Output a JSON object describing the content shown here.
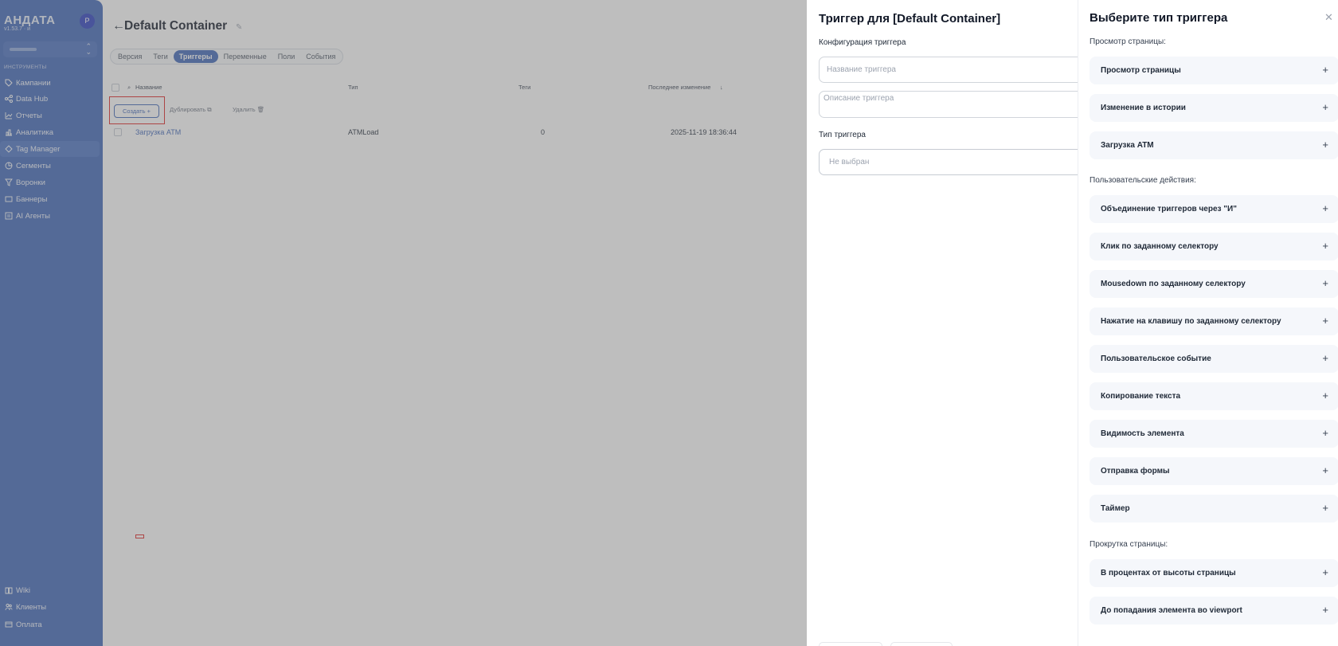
{
  "sidebar": {
    "logo": "АНДАТА",
    "version": "v1.53.7 · и",
    "avatar": "Р",
    "section": "ИНСТРУМЕНТЫ",
    "items": [
      {
        "label": "Кампании",
        "icon": "tag-icon"
      },
      {
        "label": "Data Hub",
        "icon": "share-icon"
      },
      {
        "label": "Отчеты",
        "icon": "chart-line-icon"
      },
      {
        "label": "Аналитика",
        "icon": "bar-chart-icon"
      },
      {
        "label": "Tag Manager",
        "icon": "diamond-icon"
      },
      {
        "label": "Сегменты",
        "icon": "pie-icon"
      },
      {
        "label": "Воронки",
        "icon": "funnel-icon"
      },
      {
        "label": "Баннеры",
        "icon": "banner-icon"
      },
      {
        "label": "AI Агенты",
        "icon": "ai-icon"
      }
    ],
    "bottom": [
      {
        "label": "Wiki",
        "icon": "book-icon"
      },
      {
        "label": "Клиенты",
        "icon": "users-icon"
      },
      {
        "label": "Оплата",
        "icon": "card-icon"
      }
    ]
  },
  "main": {
    "back": "←",
    "title": "Default Container",
    "tabs": [
      "Версия",
      "Теги",
      "Триггеры",
      "Переменные",
      "Поли",
      "События"
    ],
    "columns": {
      "name": "Название",
      "type": "Тип",
      "tags": "Теги",
      "modified": "Последнее изменение"
    },
    "toolbar": {
      "create": "Создать +",
      "duplicate": "Дублировать",
      "delete": "Удалить"
    },
    "rows": [
      {
        "name": "Загрузка ATM",
        "type": "ATMLoad",
        "tags": "0",
        "modified": "2025-11-19 18:36:44"
      }
    ]
  },
  "config": {
    "title": "Триггер для [Default Container]",
    "subtitle": "Конфигурация триггера",
    "name_placeholder": "Название триггера",
    "desc_placeholder": "Описание триггера",
    "type_label": "Тип триггера",
    "type_value": "Не выбран"
  },
  "types": {
    "title": "Выберите тип триггера",
    "groups": [
      {
        "label": "Просмотр страницы:",
        "items": [
          "Просмотр страницы",
          "Изменение в истории",
          "Загрузка ATM"
        ]
      },
      {
        "label": "Пользовательские действия:",
        "items": [
          "Объединение триггеров через \"И\"",
          "Клик по заданному селектору",
          "Mousedown по заданному селектору",
          "Нажатие на клавишу по заданному селектору",
          "Пользовательское событие",
          "Копирование текста",
          "Видимость элемента",
          "Отправка формы",
          "Таймер"
        ]
      },
      {
        "label": "Прокрутка страницы:",
        "items": [
          "В процентах от высоты страницы",
          "До попадания элемента во viewport"
        ]
      }
    ]
  }
}
